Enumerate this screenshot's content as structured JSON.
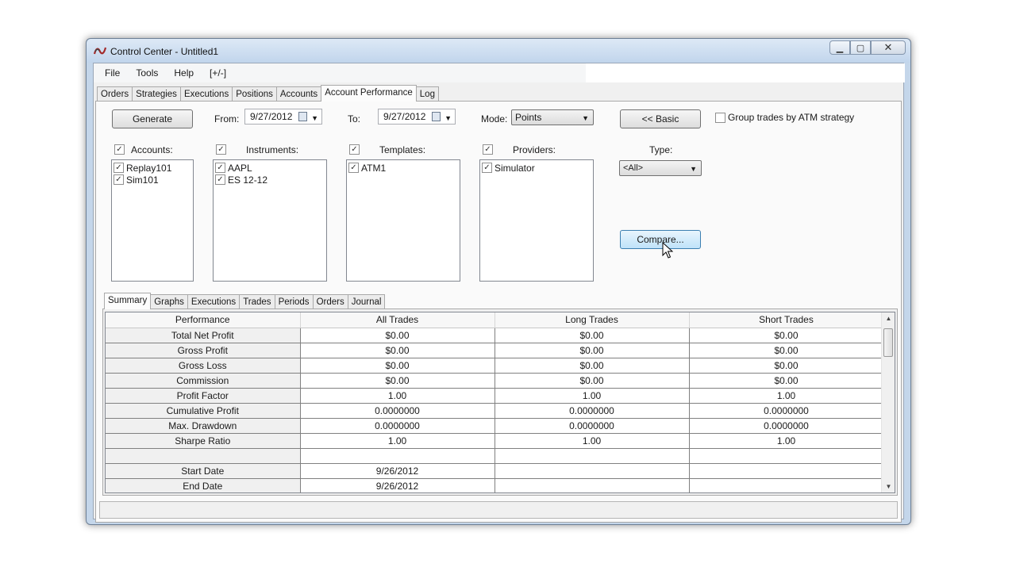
{
  "window": {
    "title": "Control Center - Untitled1"
  },
  "menu": {
    "items": [
      "File",
      "Tools",
      "Help",
      "[+/-]"
    ]
  },
  "main_tabs": [
    "Orders",
    "Strategies",
    "Executions",
    "Positions",
    "Accounts",
    "Account Performance",
    "Log"
  ],
  "controls": {
    "generate_label": "Generate",
    "from_label": "From:",
    "from_value": "9/27/2012",
    "to_label": "To:",
    "to_value": "9/27/2012",
    "mode_label": "Mode:",
    "mode_value": "Points",
    "basic_label": "<< Basic",
    "group_trades_label": "Group trades by ATM strategy",
    "type_label": "Type:",
    "type_value": "<All>",
    "compare_label": "Compare..."
  },
  "filters": {
    "accounts": {
      "label": "Accounts:",
      "items": [
        "Replay101",
        "Sim101"
      ]
    },
    "instruments": {
      "label": "Instruments:",
      "items": [
        "AAPL",
        "ES 12-12"
      ]
    },
    "templates": {
      "label": "Templates:",
      "items": [
        "ATM1"
      ]
    },
    "providers": {
      "label": "Providers:",
      "items": [
        "Simulator"
      ]
    }
  },
  "sub_tabs": [
    "Summary",
    "Graphs",
    "Executions",
    "Trades",
    "Periods",
    "Orders",
    "Journal"
  ],
  "grid": {
    "headers": [
      "Performance",
      "All Trades",
      "Long Trades",
      "Short Trades"
    ],
    "rows": [
      [
        "Total Net Profit",
        "$0.00",
        "$0.00",
        "$0.00"
      ],
      [
        "Gross Profit",
        "$0.00",
        "$0.00",
        "$0.00"
      ],
      [
        "Gross Loss",
        "$0.00",
        "$0.00",
        "$0.00"
      ],
      [
        "Commission",
        "$0.00",
        "$0.00",
        "$0.00"
      ],
      [
        "Profit Factor",
        "1.00",
        "1.00",
        "1.00"
      ],
      [
        "Cumulative Profit",
        "0.0000000",
        "0.0000000",
        "0.0000000"
      ],
      [
        "Max. Drawdown",
        "0.0000000",
        "0.0000000",
        "0.0000000"
      ],
      [
        "Sharpe Ratio",
        "1.00",
        "1.00",
        "1.00"
      ],
      [
        "",
        "",
        "",
        ""
      ],
      [
        "Start Date",
        "9/26/2012",
        "",
        ""
      ],
      [
        "End Date",
        "9/26/2012",
        "",
        ""
      ]
    ]
  },
  "colors": {
    "window_frame": "#c4d6ea",
    "compare_button": "#bfe2f9",
    "panel": "#f0f0f0"
  }
}
